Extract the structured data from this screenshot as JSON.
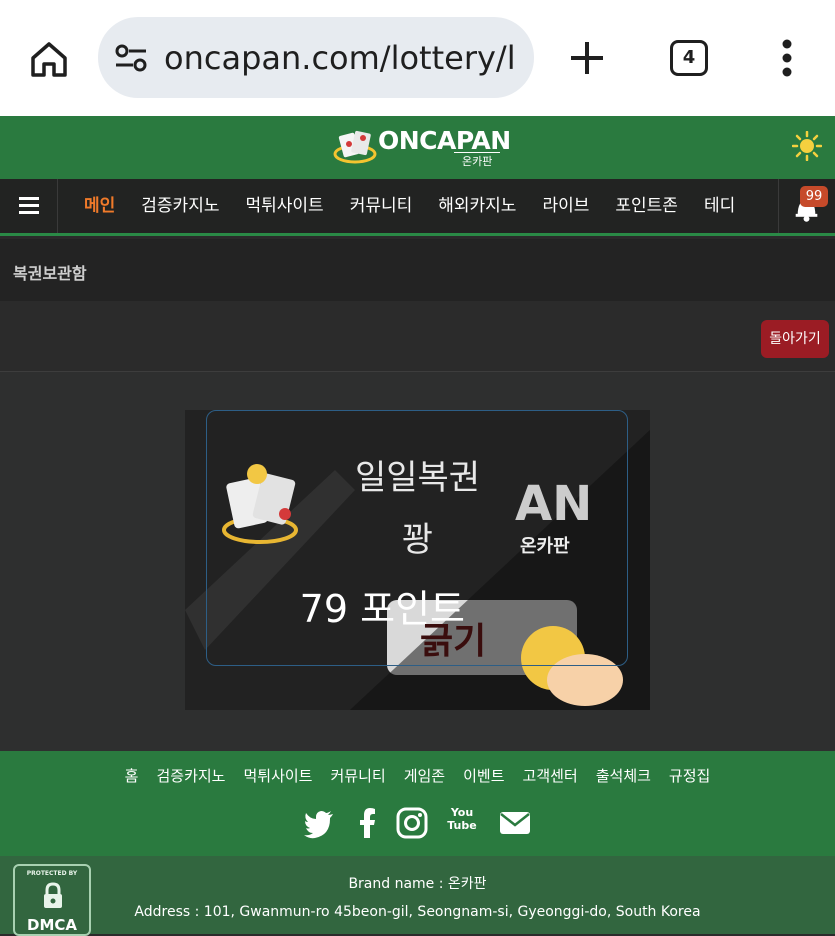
{
  "browser": {
    "url": "oncapan.com/lottery/l",
    "tab_count": "4",
    "icons": [
      "home-icon",
      "tune-icon",
      "plus-icon",
      "tabs-icon",
      "more-vert-icon"
    ]
  },
  "site": {
    "logo_text": "ONCAPAN",
    "logo_sub": "온카판",
    "theme_icon": "sun-icon",
    "colors": {
      "header_green": "#2a7a3f",
      "active_orange": "#f07a2a",
      "back_red": "#9b1c24"
    }
  },
  "nav": {
    "items": [
      {
        "label": "메인",
        "active": true
      },
      {
        "label": "검증카지노",
        "active": false
      },
      {
        "label": "먹튀사이트",
        "active": false
      },
      {
        "label": "커뮤니티",
        "active": false
      },
      {
        "label": "해외카지노",
        "active": false
      },
      {
        "label": "라이브",
        "active": false
      },
      {
        "label": "포인트존",
        "active": false
      },
      {
        "label": "테디",
        "active": false
      }
    ],
    "notification_count": "99"
  },
  "page": {
    "title": "복권보관함",
    "back_label": "돌아가기"
  },
  "ticket": {
    "line1": "일일복권",
    "line2": "꽝",
    "line3": "79 포인트",
    "scratch_label": "긁기",
    "brand_sub": "온카판"
  },
  "footer": {
    "links": [
      "홈",
      "검증카지노",
      "먹튀사이트",
      "커뮤니티",
      "게임존",
      "이벤트",
      "고객센터",
      "출석체크",
      "규정집"
    ],
    "social_icons": [
      "twitter-icon",
      "facebook-icon",
      "instagram-icon",
      "youtube-icon",
      "email-icon"
    ],
    "youtube_text": "You Tube",
    "dmca_top": "PROTECTED BY",
    "dmca_text": "DMCA",
    "brand_line": "Brand name : 온카판",
    "address_line": "Address : 101, Gwanmun-ro 45beon-gil, Seongnam-si, Gyeonggi-do, South Korea"
  }
}
